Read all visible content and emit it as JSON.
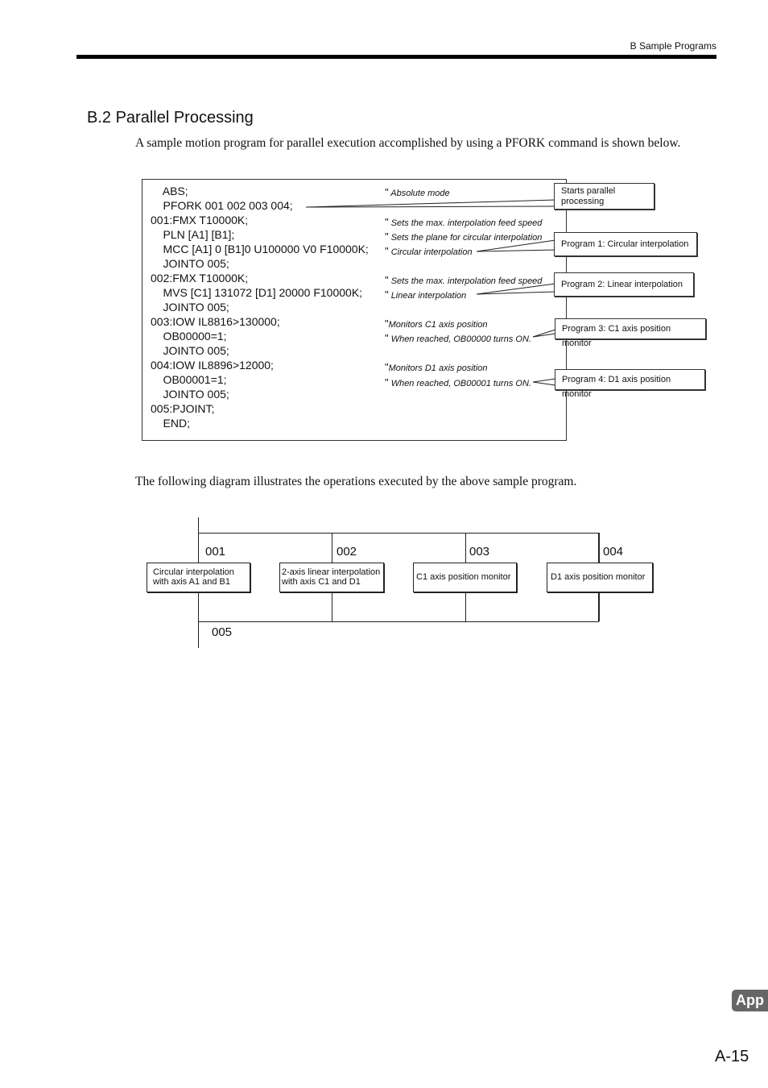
{
  "header": {
    "chapter": "B  Sample Programs"
  },
  "section": {
    "title": "B.2  Parallel Processing",
    "intro": "A sample motion program for parallel execution accomplished by using a PFORK command is shown below.",
    "intro2": "The following diagram illustrates the operations executed by the above sample program."
  },
  "program": {
    "lines": [
      "    ABS;",
      "    PFORK 001 002 003 004;",
      "001:FMX T10000K;",
      "    PLN [A1] [B1];",
      "    MCC [A1] 0 [B1]0 U100000 V0 F10000K;",
      "    JOINTO 005;",
      "002:FMX T10000K;",
      "    MVS [C1] 131072 [D1] 20000 F10000K;",
      "    JOINTO 005;",
      "003:IOW IL8816>130000;",
      "    OB00000=1;",
      "    JOINTO 005;",
      "004:IOW IL8896>12000;",
      "    OB00001=1;",
      "    JOINTO 005;",
      "005:PJOINT;",
      "    END;"
    ],
    "comment_mark": "\"",
    "comments": [
      "Absolute mode",
      "Sets the max. interpolation feed speed",
      "Sets the plane for circular interpolation",
      "Circular interpolation",
      "Sets the max. interpolation feed speed",
      "Linear interpolation",
      "Monitors C1 axis position",
      "When reached, OB00000 turns ON.",
      "Monitors D1 axis position",
      "When reached, OB00001 turns ON."
    ],
    "callouts": [
      "Starts parallel processing",
      "Program 1: Circular interpolation",
      "Program 2: Linear interpolation",
      "Program 3: C1 axis position monitor",
      "Program 4: D1 axis position monitor"
    ]
  },
  "diagram": {
    "tasks": [
      {
        "id": "001",
        "label": "Circular interpolation with axis A1 and B1"
      },
      {
        "id": "002",
        "label": "2-axis linear interpolation with axis C1 and D1"
      },
      {
        "id": "003",
        "label": "C1 axis position monitor"
      },
      {
        "id": "004",
        "label": "D1 axis position monitor"
      }
    ],
    "join_id": "005"
  },
  "footer": {
    "tab": "App",
    "page": "A-15"
  }
}
